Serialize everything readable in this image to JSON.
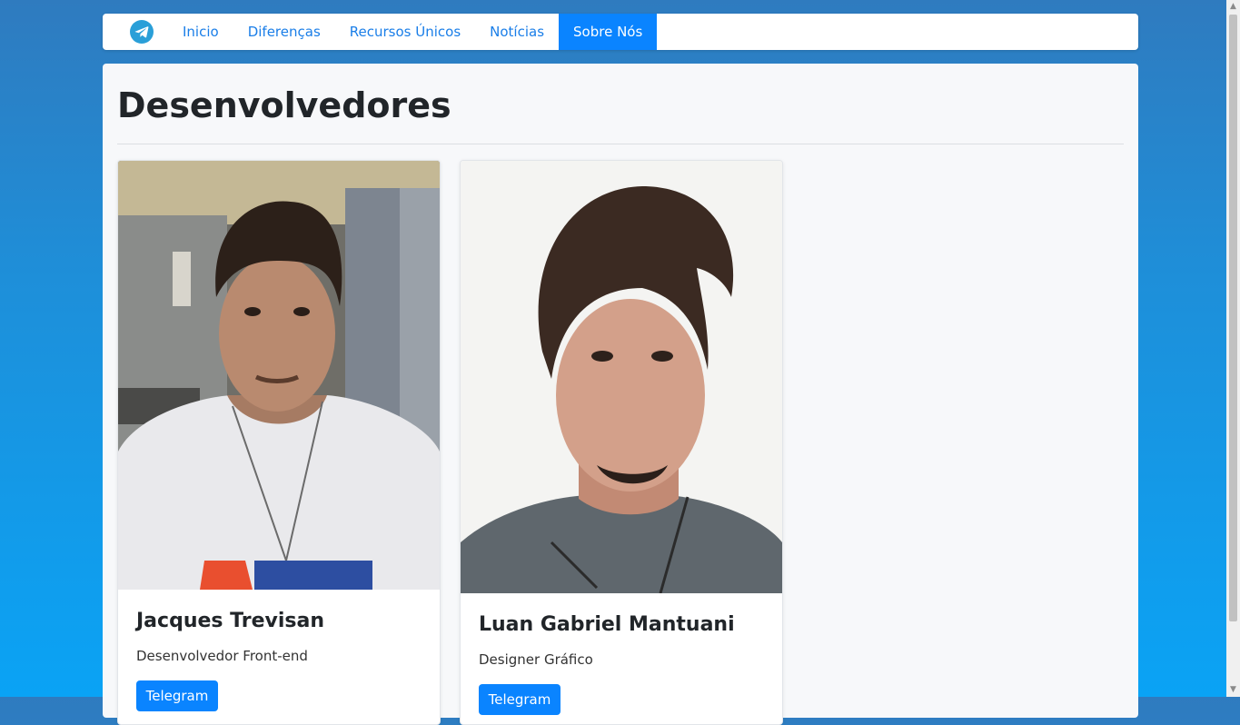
{
  "nav": {
    "brand_icon": "telegram-icon",
    "items": [
      {
        "label": "Inicio"
      },
      {
        "label": "Diferenças"
      },
      {
        "label": "Recursos Únicos"
      },
      {
        "label": "Notícias"
      },
      {
        "label": "Sobre Nós"
      }
    ],
    "active_index": 4
  },
  "page": {
    "title": "Desenvolvedores"
  },
  "cards": [
    {
      "name": "Jacques Trevisan",
      "role": "Desenvolvedor Front-end",
      "button_label": "Telegram"
    },
    {
      "name": "Luan Gabriel Mantuani",
      "role": "Designer Gráfico",
      "button_label": "Telegram"
    }
  ],
  "colors": {
    "accent": "#0a84ff",
    "link": "#1a7ee8",
    "background_top": "#2f7bbf",
    "background_bottom": "#0aa3f5"
  }
}
